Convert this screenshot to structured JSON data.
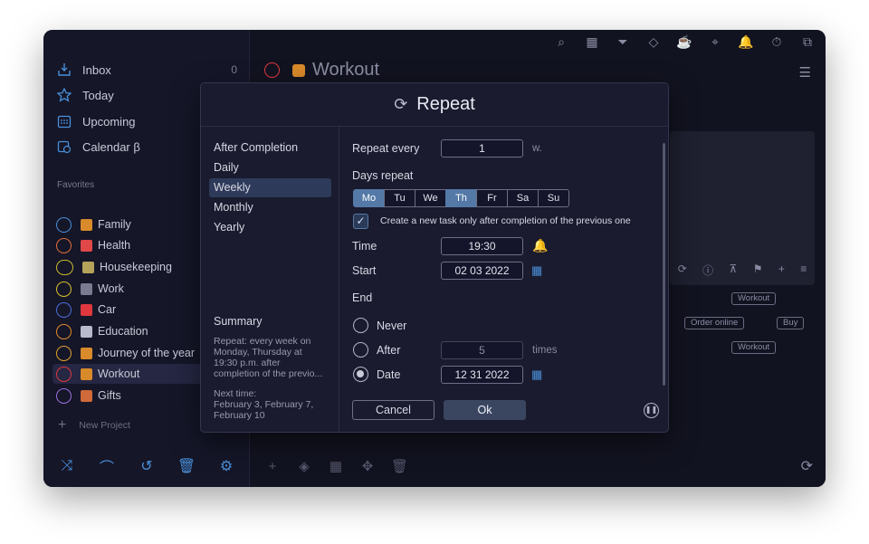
{
  "sidebar": {
    "nav": [
      {
        "label": "Inbox",
        "count": "0",
        "icon": "inbox-icon"
      },
      {
        "label": "Today",
        "icon": "star-icon"
      },
      {
        "label": "Upcoming",
        "icon": "calendar-grid-icon"
      },
      {
        "label": "Calendar β",
        "icon": "calendar-clock-icon"
      }
    ],
    "favorites_label": "Favorites",
    "projects": [
      {
        "label": "Family",
        "ring": "#4a8fd8",
        "emoji_color": "#d98a2a"
      },
      {
        "label": "Health",
        "ring": "#e06b3a",
        "emoji_color": "#e04848"
      },
      {
        "label": "Housekeeping",
        "ring": "#c8b830",
        "emoji_color": "#b5a35a"
      },
      {
        "label": "Work",
        "ring": "#d8c030",
        "emoji_color": "#7a7b90"
      },
      {
        "label": "Car",
        "ring": "#4a6ed8",
        "emoji_color": "#e0383e"
      },
      {
        "label": "Education",
        "ring": "#e08a2a",
        "emoji_color": "#b9bacc"
      },
      {
        "label": "Journey of the year",
        "ring": "#e0a030",
        "emoji_color": "#d98a2a"
      },
      {
        "label": "Workout",
        "ring": "#e0383e",
        "emoji_color": "#d98a2a"
      },
      {
        "label": "Gifts",
        "ring": "#9a6ee0",
        "emoji_color": "#d06a3a"
      }
    ],
    "new_project": "New Project"
  },
  "main": {
    "project_title": "Workout",
    "tags": [
      "Workout",
      "Order online",
      "Buy",
      "Workout"
    ]
  },
  "dialog": {
    "title": "Repeat",
    "options": [
      "After Completion",
      "Daily",
      "Weekly",
      "Monthly",
      "Yearly"
    ],
    "selected_option": "Weekly",
    "summary_title": "Summary",
    "summary_text": "Repeat: every week on\nMonday, Thursday at\n19:30 p.m. after\ncompletion of the previo...",
    "next_time": "Next time:\nFebruary 3, February 7,\nFebruary 10",
    "repeat_every_label": "Repeat every",
    "repeat_every_value": "1",
    "repeat_every_unit": "w.",
    "days_label": "Days repeat",
    "days": [
      {
        "label": "Mo",
        "on": true
      },
      {
        "label": "Tu",
        "on": false
      },
      {
        "label": "We",
        "on": false
      },
      {
        "label": "Th",
        "on": true
      },
      {
        "label": "Fr",
        "on": false
      },
      {
        "label": "Sa",
        "on": false
      },
      {
        "label": "Su",
        "on": false
      }
    ],
    "after_completion_checked": true,
    "after_completion_label": "Create a new task only after completion of the previous one",
    "time_label": "Time",
    "time_value": "19:30",
    "start_label": "Start",
    "start_value": "02 03 2022",
    "end_label": "End",
    "end_never": "Never",
    "end_after": "After",
    "end_after_value": "5",
    "end_after_unit": "times",
    "end_date": "Date",
    "end_date_value": "12 31 2022",
    "end_selected": "Date",
    "cancel_label": "Cancel",
    "ok_label": "Ok"
  }
}
